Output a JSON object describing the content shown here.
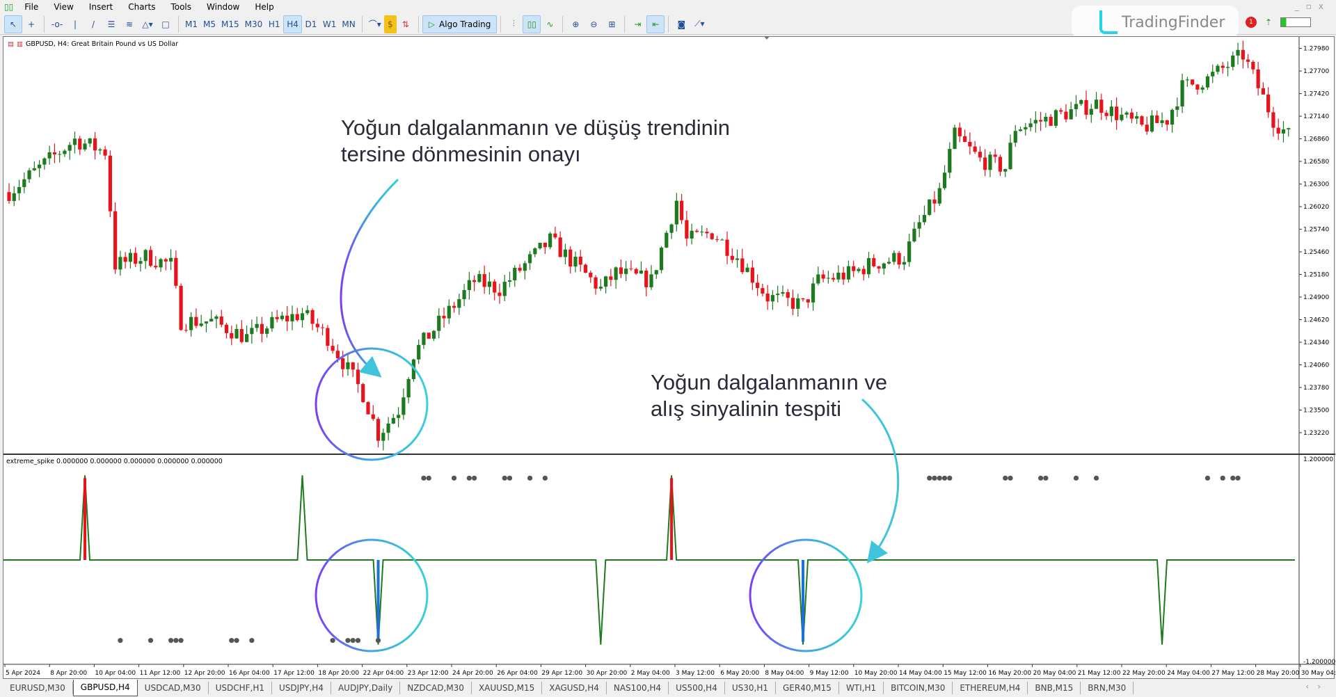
{
  "menu": {
    "items": [
      "File",
      "View",
      "Insert",
      "Charts",
      "Tools",
      "Window",
      "Help"
    ]
  },
  "toolbar": {
    "timeframes": [
      "M1",
      "M5",
      "M15",
      "M30",
      "H1",
      "H4",
      "D1",
      "W1",
      "MN"
    ],
    "active_timeframe": "H4",
    "algo_label": "Algo Trading",
    "notification_count": "1"
  },
  "brand": {
    "name": "TradingFinder"
  },
  "chart": {
    "title": "GBPUSD, H4:  Great Britain Pound vs US Dollar",
    "price_labels": [
      "1.27980",
      "1.27700",
      "1.27420",
      "1.27140",
      "1.26860",
      "1.26580",
      "1.26300",
      "1.26020",
      "1.25740",
      "1.25460",
      "1.25180",
      "1.24900",
      "1.24620",
      "1.24340",
      "1.24060",
      "1.23780",
      "1.23500",
      "1.23220"
    ],
    "price_range": [
      1.2322,
      1.2798
    ],
    "price_path": [
      [
        0,
        1.262
      ],
      [
        13,
        1.2685
      ],
      [
        19,
        1.267
      ],
      [
        21,
        1.253
      ],
      [
        27,
        1.254
      ],
      [
        32,
        1.253
      ],
      [
        34,
        1.246
      ],
      [
        40,
        1.246
      ],
      [
        47,
        1.244
      ],
      [
        53,
        1.246
      ],
      [
        58,
        1.247
      ],
      [
        63,
        1.244
      ],
      [
        67,
        1.24
      ],
      [
        70,
        1.237
      ],
      [
        73,
        1.232
      ],
      [
        77,
        1.235
      ],
      [
        80,
        1.242
      ],
      [
        84,
        1.245
      ],
      [
        92,
        1.251
      ],
      [
        97,
        1.25
      ],
      [
        107,
        1.256
      ],
      [
        117,
        1.25
      ],
      [
        120,
        1.252
      ],
      [
        127,
        1.251
      ],
      [
        132,
        1.261
      ],
      [
        134,
        1.256
      ],
      [
        139,
        1.257
      ],
      [
        144,
        1.254
      ],
      [
        150,
        1.249
      ],
      [
        157,
        1.248
      ],
      [
        160,
        1.251
      ],
      [
        167,
        1.252
      ],
      [
        170,
        1.253
      ],
      [
        177,
        1.254
      ],
      [
        180,
        1.258
      ],
      [
        184,
        1.262
      ],
      [
        187,
        1.269
      ],
      [
        192,
        1.266
      ],
      [
        197,
        1.265
      ],
      [
        199,
        1.27
      ],
      [
        205,
        1.271
      ],
      [
        215,
        1.273
      ],
      [
        224,
        1.27
      ],
      [
        229,
        1.271
      ],
      [
        232,
        1.275
      ],
      [
        237,
        1.276
      ],
      [
        244,
        1.279
      ],
      [
        250,
        1.271
      ],
      [
        253,
        1.269
      ]
    ],
    "bull_color": "#1e7a1e",
    "bear_color": "#e8141c",
    "time_labels": [
      "5 Apr 2024",
      "8 Apr 20:00",
      "10 Apr 04:00",
      "11 Apr 12:00",
      "12 Apr 20:00",
      "16 Apr 04:00",
      "17 Apr 12:00",
      "18 Apr 20:00",
      "22 Apr 04:00",
      "23 Apr 12:00",
      "24 Apr 20:00",
      "26 Apr 04:00",
      "29 Apr 12:00",
      "30 Apr 20:00",
      "2 May 04:00",
      "3 May 12:00",
      "6 May 20:00",
      "8 May 04:00",
      "9 May 12:00",
      "10 May 20:00",
      "14 May 04:00",
      "15 May 12:00",
      "16 May 20:00",
      "20 May 04:00",
      "21 May 12:00",
      "22 May 20:00",
      "24 May 04:00",
      "27 May 12:00",
      "28 May 20:00",
      "30 May 04:00"
    ]
  },
  "indicator": {
    "label": "extreme_spike 0.000000 0.000000 0.000000 0.000000 0.000000",
    "max_label": "1.200000",
    "min_label": "-1.200000",
    "range": [
      -1.2,
      1.2
    ],
    "up_spikes": [
      15,
      58,
      131
    ],
    "down_spikes": [
      73,
      117,
      157,
      228
    ],
    "highlight_up": [
      15,
      131
    ],
    "highlight_down": [
      73,
      157
    ],
    "top_dots": [
      82,
      83,
      88,
      91,
      92,
      98,
      99,
      103,
      106,
      182,
      183,
      184,
      185,
      186,
      197,
      198,
      204,
      205,
      211,
      215,
      237,
      240,
      242,
      243
    ],
    "bottom_dots": [
      22,
      28,
      32,
      33,
      34,
      44,
      45,
      48,
      64,
      67,
      68,
      69,
      73
    ],
    "line_color": "#1e7a1e",
    "up_color": "#e8141c",
    "down_color": "#1e6fd6"
  },
  "annotations": {
    "top": [
      "Yoğun dalgalanmanın ve düşüş trendinin",
      "tersine dönmesinin onayı"
    ],
    "bottom": [
      "Yoğun dalgalanmanın ve",
      "alış sinyalinin tespiti"
    ]
  },
  "tabs": [
    "EURUSD,M30",
    "GBPUSD,H4",
    "USDCAD,M30",
    "USDCHF,H1",
    "USDJPY,H4",
    "AUDJPY,Daily",
    "NZDCAD,M30",
    "XAUUSD,M15",
    "XAGUSD,H4",
    "NAS100,H4",
    "US500,H4",
    "US30,H1",
    "GER40,M15",
    "WTI,H1",
    "BITCOIN,M30",
    "ETHEREUM,H4",
    "BNB,M15",
    "BRN,M30"
  ],
  "active_tab": "GBPUSD,H4"
}
